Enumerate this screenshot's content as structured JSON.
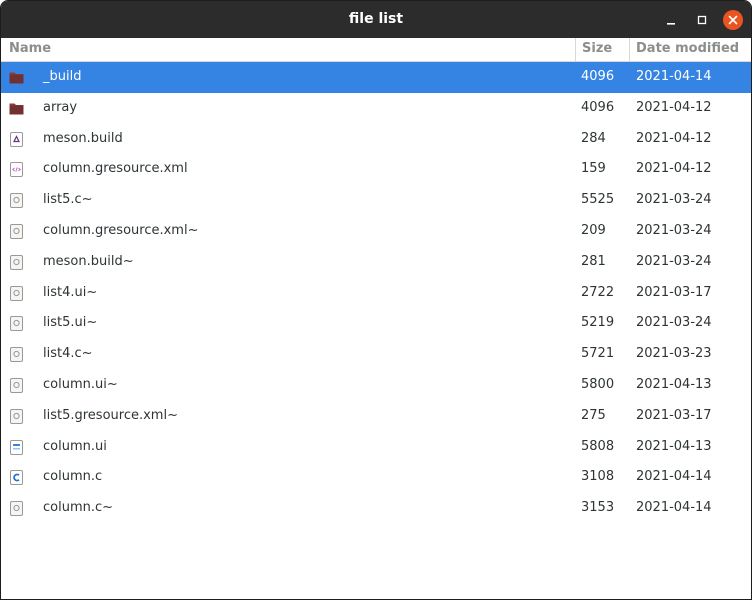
{
  "window": {
    "title": "file list"
  },
  "columns": {
    "name": "Name",
    "size": "Size",
    "date": "Date modified"
  },
  "colors": {
    "selection": "#3584e4",
    "titlebar": "#2c2c2c",
    "close": "#e95420",
    "folder": "#8a3b3b"
  },
  "files": [
    {
      "name": "_build",
      "size": "4096",
      "date": "2021-04-14",
      "icon": "folder-icon",
      "selected": true
    },
    {
      "name": "array",
      "size": "4096",
      "date": "2021-04-12",
      "icon": "folder-icon"
    },
    {
      "name": "meson.build",
      "size": "284",
      "date": "2021-04-12",
      "icon": "meson-file-icon"
    },
    {
      "name": "column.gresource.xml",
      "size": "159",
      "date": "2021-04-12",
      "icon": "xml-file-icon"
    },
    {
      "name": "list5.c~",
      "size": "5525",
      "date": "2021-03-24",
      "icon": "backup-file-icon"
    },
    {
      "name": "column.gresource.xml~",
      "size": "209",
      "date": "2021-03-24",
      "icon": "backup-file-icon"
    },
    {
      "name": "meson.build~",
      "size": "281",
      "date": "2021-03-24",
      "icon": "backup-file-icon"
    },
    {
      "name": "list4.ui~",
      "size": "2722",
      "date": "2021-03-17",
      "icon": "backup-file-icon"
    },
    {
      "name": "list5.ui~",
      "size": "5219",
      "date": "2021-03-24",
      "icon": "backup-file-icon"
    },
    {
      "name": "list4.c~",
      "size": "5721",
      "date": "2021-03-23",
      "icon": "backup-file-icon"
    },
    {
      "name": "column.ui~",
      "size": "5800",
      "date": "2021-04-13",
      "icon": "backup-file-icon"
    },
    {
      "name": "list5.gresource.xml~",
      "size": "275",
      "date": "2021-03-17",
      "icon": "backup-file-icon"
    },
    {
      "name": "column.ui",
      "size": "5808",
      "date": "2021-04-13",
      "icon": "ui-file-icon"
    },
    {
      "name": "column.c",
      "size": "3108",
      "date": "2021-04-14",
      "icon": "c-source-icon"
    },
    {
      "name": "column.c~",
      "size": "3153",
      "date": "2021-04-14",
      "icon": "backup-file-icon"
    }
  ]
}
